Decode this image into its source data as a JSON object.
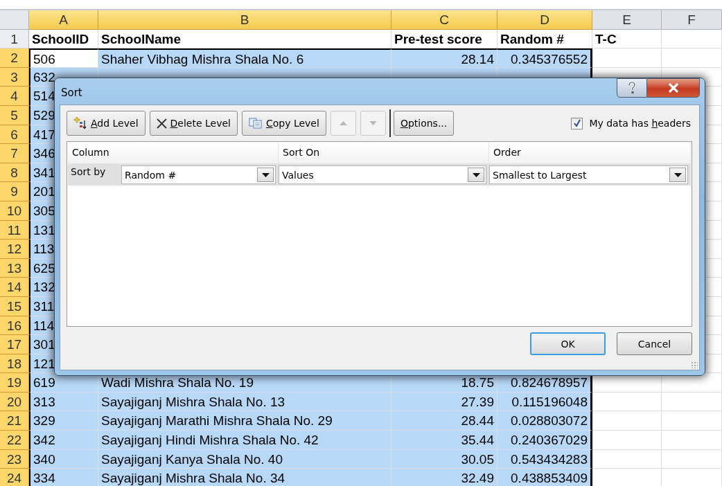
{
  "sheet": {
    "columns": [
      {
        "label": "A",
        "selected": true
      },
      {
        "label": "B",
        "selected": true
      },
      {
        "label": "C",
        "selected": true
      },
      {
        "label": "D",
        "selected": true
      },
      {
        "label": "E",
        "selected": false
      },
      {
        "label": "F",
        "selected": false
      }
    ],
    "header_row": {
      "number": "1",
      "cells": [
        "SchoolID",
        "SchoolName",
        "Pre-test score",
        "Random #",
        "T-C"
      ]
    },
    "rows": [
      {
        "number": "2",
        "selected": true,
        "active": true,
        "id": "506",
        "name": "Shaher Vibhag Mishra Shala No. 6",
        "score": "28.14",
        "random": "0.345376552"
      },
      {
        "number": "3",
        "selected": true,
        "active": false,
        "id": "632"
      },
      {
        "number": "4",
        "selected": true,
        "active": false,
        "id": "514"
      },
      {
        "number": "5",
        "selected": true,
        "active": false,
        "id": "529"
      },
      {
        "number": "6",
        "selected": true,
        "active": false,
        "id": "417"
      },
      {
        "number": "7",
        "selected": true,
        "active": false,
        "id": "346"
      },
      {
        "number": "8",
        "selected": true,
        "active": false,
        "id": "341"
      },
      {
        "number": "9",
        "selected": true,
        "active": false,
        "id": "201"
      },
      {
        "number": "10",
        "selected": true,
        "active": false,
        "id": "305"
      },
      {
        "number": "11",
        "selected": true,
        "active": false,
        "id": "131"
      },
      {
        "number": "12",
        "selected": true,
        "active": false,
        "id": "113"
      },
      {
        "number": "13",
        "selected": true,
        "active": false,
        "id": "625"
      },
      {
        "number": "14",
        "selected": true,
        "active": false,
        "id": "132"
      },
      {
        "number": "15",
        "selected": true,
        "active": false,
        "id": "311"
      },
      {
        "number": "16",
        "selected": true,
        "active": false,
        "id": "114"
      },
      {
        "number": "17",
        "selected": true,
        "active": false,
        "id": "301"
      },
      {
        "number": "18",
        "selected": true,
        "active": false,
        "id": "121"
      },
      {
        "number": "19",
        "selected": true,
        "active": false,
        "id": "619",
        "name": "Wadi Mishra Shala No. 19",
        "score": "18.75",
        "random": "0.824678957"
      },
      {
        "number": "20",
        "selected": true,
        "active": false,
        "id": "313",
        "name": "Sayajiganj Mishra Shala No. 13",
        "score": "27.39",
        "random": "0.115196048"
      },
      {
        "number": "21",
        "selected": true,
        "active": false,
        "id": "329",
        "name": "Sayajiganj Marathi Mishra Shala No. 29",
        "score": "28.44",
        "random": "0.028803072"
      },
      {
        "number": "22",
        "selected": true,
        "active": false,
        "id": "342",
        "name": "Sayajiganj Hindi Mishra Shala No. 42",
        "score": "35.44",
        "random": "0.240367029"
      },
      {
        "number": "23",
        "selected": true,
        "active": false,
        "id": "340",
        "name": "Sayajiganj Kanya Shala No. 40",
        "score": "30.05",
        "random": "0.543434283"
      },
      {
        "number": "24",
        "selected": true,
        "active": false,
        "id": "334",
        "name": "Sayajiganj Mishra Shala No. 34",
        "score": "32.49",
        "random": "0.438853409"
      }
    ]
  },
  "dialog": {
    "title": "Sort",
    "toolbar": [
      {
        "kind": "add",
        "key": "A",
        "after": "dd Level"
      },
      {
        "kind": "delete",
        "key": "D",
        "after": "elete Level"
      },
      {
        "kind": "copy",
        "key": "C",
        "after": "opy Level"
      },
      {
        "kind": "up",
        "disabled": true
      },
      {
        "kind": "down",
        "disabled": true
      },
      {
        "kind": "options",
        "key": "O",
        "after": "ptions..."
      }
    ],
    "headers_checkbox": {
      "before": "My data has ",
      "key": "h",
      "after": "eaders",
      "checked": true
    },
    "columns": [
      "Column",
      "Sort On",
      "Order"
    ],
    "levels": [
      {
        "label": "Sort by",
        "column": "Random #",
        "sort_on": "Values",
        "order": "Smallest to Largest",
        "selected": true
      }
    ],
    "buttons": [
      {
        "label": "OK",
        "default": true
      },
      {
        "label": "Cancel",
        "default": false
      }
    ]
  }
}
